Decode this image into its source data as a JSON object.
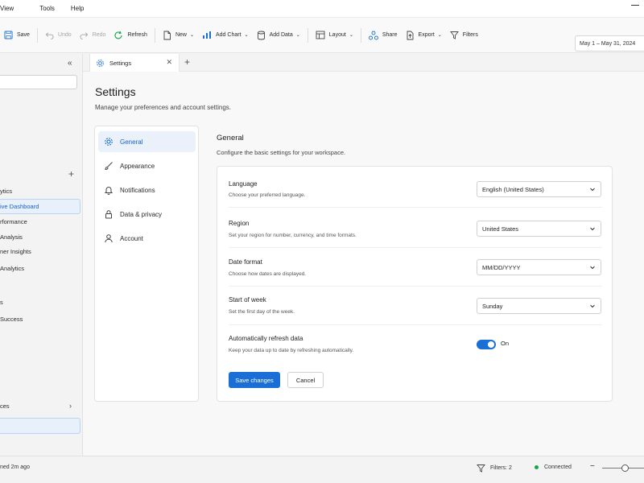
{
  "menu": {
    "items": [
      "View",
      "Tools",
      "Help"
    ]
  },
  "toolbar": {
    "save": "Save",
    "undo": "Undo",
    "redo": "Redo",
    "refresh": "Refresh",
    "new": "New",
    "add_chart": "Add Chart",
    "add_data": "Add Data",
    "layout": "Layout",
    "share": "Share",
    "export": "Export",
    "filters": "Filters",
    "date_range": "May 1 – May 31, 2024"
  },
  "left_pane": {
    "items": [
      "ytics",
      "ive Dashboard",
      "rformance",
      "Analysis",
      "ner Insights",
      "Analytics",
      "s",
      "Success",
      "ces"
    ],
    "active_index": 1
  },
  "tab": {
    "label": "Settings"
  },
  "page": {
    "title": "Settings",
    "subtitle": "Manage your preferences and account settings."
  },
  "nav": {
    "items": [
      {
        "label": "General",
        "icon": "gear-icon"
      },
      {
        "label": "Appearance",
        "icon": "brush-icon"
      },
      {
        "label": "Notifications",
        "icon": "bell-icon"
      },
      {
        "label": "Data & privacy",
        "icon": "lock-icon"
      },
      {
        "label": "Account",
        "icon": "person-icon"
      }
    ],
    "active_index": 0
  },
  "section": {
    "title": "General",
    "subtitle": "Configure the basic settings for your workspace."
  },
  "settings": {
    "language": {
      "label": "Language",
      "desc": "Choose your preferred language.",
      "value": "English (United States)"
    },
    "region": {
      "label": "Region",
      "desc": "Set your region for number, currency, and time formats.",
      "value": "United States"
    },
    "date_format": {
      "label": "Date format",
      "desc": "Choose how dates are displayed.",
      "value": "MM/DD/YYYY"
    },
    "start_of_week": {
      "label": "Start of week",
      "desc": "Set the first day of the week.",
      "value": "Sunday"
    },
    "auto_refresh": {
      "label": "Automatically refresh data",
      "desc": "Keep your data up to date by refreshing automatically.",
      "state": "On",
      "enabled": true
    }
  },
  "actions": {
    "save": "Save changes",
    "cancel": "Cancel"
  },
  "status": {
    "left": "ned 2m ago",
    "filters": "Filters: 2",
    "connection": "Connected"
  },
  "colors": {
    "accent": "#1a6fd6",
    "connected": "#17a44b"
  }
}
